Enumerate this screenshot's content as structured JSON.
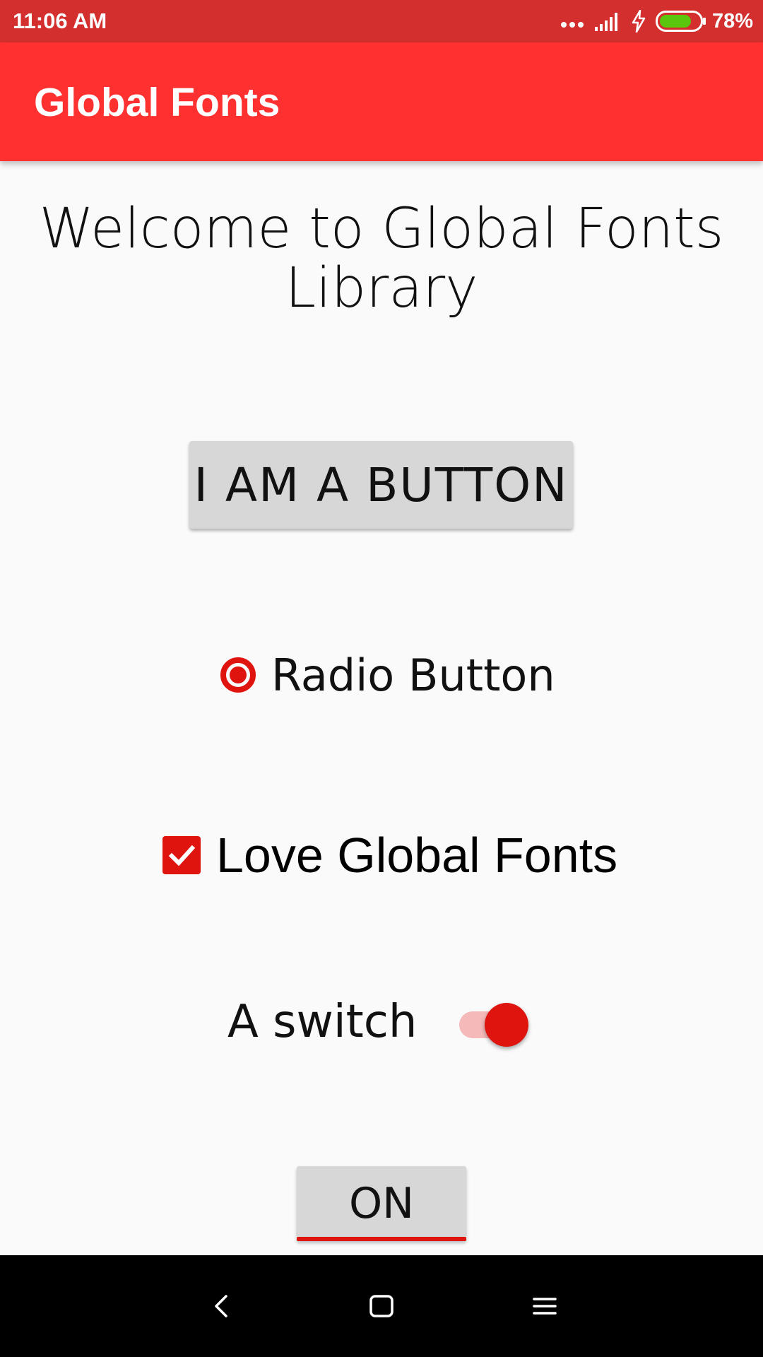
{
  "status_bar": {
    "time": "11:06 AM",
    "battery_percent": "78%",
    "battery_level": 0.78,
    "icons": [
      "more-dots-icon",
      "signal-icon",
      "charging-bolt-icon",
      "battery-icon"
    ]
  },
  "app_bar": {
    "title": "Global Fonts"
  },
  "content": {
    "welcome_text": "Welcome to Global Fonts Library",
    "primary_button_label": "I AM A BUTTON",
    "radio": {
      "label": "Radio Button",
      "checked": true
    },
    "checkbox": {
      "label": "Love Global Fonts",
      "checked": true
    },
    "switch": {
      "label": "A switch",
      "on": true
    },
    "toggle_button_label": "ON"
  },
  "nav_bar": {
    "icons": [
      "back-icon",
      "home-icon",
      "menu-icon"
    ]
  },
  "colors": {
    "status_bar": "#d32f2f",
    "app_bar": "#ff3030",
    "accent": "#e0140e",
    "background": "#fafafa",
    "nav_bar": "#000000"
  }
}
